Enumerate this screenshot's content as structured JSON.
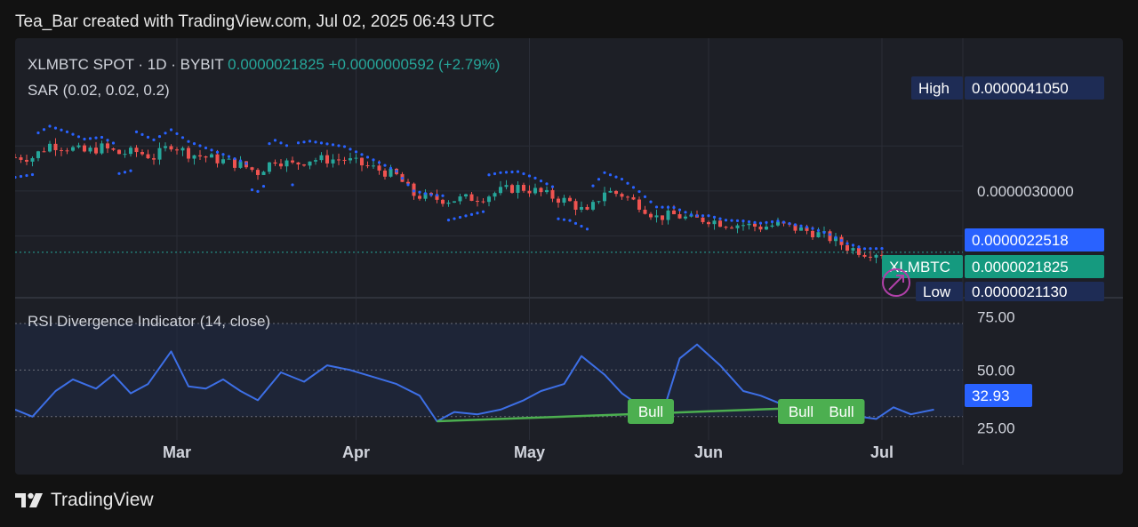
{
  "header": {
    "attribution": "Tea_Bar created with TradingView.com, Jul 02, 2025 06:43 UTC"
  },
  "legend": {
    "symbol": "XLMBTC SPOT · 1D · BYBIT",
    "price": "0.0000021825",
    "change": "+0.0000000592 (+2.79%)",
    "indicator": "SAR (0.02, 0.02, 0.2)",
    "rsi": "RSI Divergence Indicator (14, close)"
  },
  "footer": {
    "brand": "TradingView"
  },
  "colors": {
    "background": "#121212",
    "panel": "#1d1f26",
    "up": "#26a69a",
    "down": "#ef5350",
    "sar": "#2962ff",
    "rsi_line": "#3d6fe6",
    "bull": "#4caf50",
    "label_blue": "#2962ff",
    "label_navy": "#1e2c55",
    "label_green": "#159a7f"
  },
  "chart_data": [
    {
      "type": "candlestick",
      "title": "XLMBTC SPOT · 1D · BYBIT",
      "x_range": [
        "2025-02-01",
        "2025-07-15"
      ],
      "ylim": [
        1.6e-06,
        4.8e-06
      ],
      "price_scale": {
        "ticks": [
          "0.0000030000"
        ],
        "high": "0.0000041050",
        "low": "0.0000021130",
        "high_label": "High",
        "low_label": "Low",
        "marker": "0.0000022518",
        "last": "0.0000021825",
        "last_symbol": "XLMBTC"
      },
      "x_ticks": [
        {
          "label": "Mar",
          "date": "2025-03-01"
        },
        {
          "label": "Apr",
          "date": "2025-04-01"
        },
        {
          "label": "May",
          "date": "2025-05-01"
        },
        {
          "label": "Jun",
          "date": "2025-06-01"
        },
        {
          "label": "Jul",
          "date": "2025-07-01"
        }
      ],
      "candles_note": "close per session, mid-range estimate",
      "close": [
        [
          "2025-02-01",
          3.45e-06
        ],
        [
          "2025-02-04",
          3.45e-06
        ],
        [
          "2025-02-07",
          3.62e-06
        ],
        [
          "2025-02-10",
          3.58e-06
        ],
        [
          "2025-02-13",
          3.52e-06
        ],
        [
          "2025-02-16",
          3.58e-06
        ],
        [
          "2025-02-19",
          3.5e-06
        ],
        [
          "2025-02-22",
          3.52e-06
        ],
        [
          "2025-02-25",
          3.45e-06
        ],
        [
          "2025-02-28",
          3.62e-06
        ],
        [
          "2025-03-03",
          3.5e-06
        ],
        [
          "2025-03-06",
          3.45e-06
        ],
        [
          "2025-03-09",
          3.4e-06
        ],
        [
          "2025-03-12",
          3.35e-06
        ],
        [
          "2025-03-15",
          3.25e-06
        ],
        [
          "2025-03-18",
          3.42e-06
        ],
        [
          "2025-03-21",
          3.35e-06
        ],
        [
          "2025-03-24",
          3.42e-06
        ],
        [
          "2025-03-27",
          3.42e-06
        ],
        [
          "2025-03-30",
          3.42e-06
        ],
        [
          "2025-04-02",
          3.35e-06
        ],
        [
          "2025-04-05",
          3.28e-06
        ],
        [
          "2025-04-08",
          3.2e-06
        ],
        [
          "2025-04-11",
          2.95e-06
        ],
        [
          "2025-04-14",
          2.9e-06
        ],
        [
          "2025-04-17",
          2.88e-06
        ],
        [
          "2025-04-20",
          2.9e-06
        ],
        [
          "2025-04-23",
          2.92e-06
        ],
        [
          "2025-04-26",
          3e-06
        ],
        [
          "2025-04-29",
          3.05e-06
        ],
        [
          "2025-05-02",
          3e-06
        ],
        [
          "2025-05-05",
          2.92e-06
        ],
        [
          "2025-05-08",
          2.85e-06
        ],
        [
          "2025-05-11",
          2.7e-06
        ],
        [
          "2025-05-14",
          3e-06
        ],
        [
          "2025-05-17",
          2.95e-06
        ],
        [
          "2025-05-20",
          2.82e-06
        ],
        [
          "2025-05-23",
          2.65e-06
        ],
        [
          "2025-05-26",
          2.68e-06
        ],
        [
          "2025-05-29",
          2.62e-06
        ],
        [
          "2025-06-01",
          2.62e-06
        ],
        [
          "2025-06-04",
          2.56e-06
        ],
        [
          "2025-06-07",
          2.55e-06
        ],
        [
          "2025-06-10",
          2.52e-06
        ],
        [
          "2025-06-13",
          2.55e-06
        ],
        [
          "2025-06-16",
          2.5e-06
        ],
        [
          "2025-06-19",
          2.45e-06
        ],
        [
          "2025-06-22",
          2.37e-06
        ],
        [
          "2025-06-25",
          2.25e-06
        ],
        [
          "2025-06-28",
          2.18e-06
        ],
        [
          "2025-07-01",
          2.1825e-06
        ]
      ]
    },
    {
      "type": "line",
      "title": "RSI Divergence Indicator (14, close)",
      "ylim": [
        20,
        78
      ],
      "y_ticks": [
        "75.00",
        "50.00",
        "25.00"
      ],
      "current": "32.93",
      "rsi": [
        [
          "2025-02-01",
          33
        ],
        [
          "2025-02-04",
          30
        ],
        [
          "2025-02-08",
          41
        ],
        [
          "2025-02-11",
          46
        ],
        [
          "2025-02-15",
          42
        ],
        [
          "2025-02-18",
          48
        ],
        [
          "2025-02-21",
          40
        ],
        [
          "2025-02-24",
          44
        ],
        [
          "2025-02-28",
          58
        ],
        [
          "2025-03-03",
          43
        ],
        [
          "2025-03-06",
          42
        ],
        [
          "2025-03-09",
          46
        ],
        [
          "2025-03-12",
          41
        ],
        [
          "2025-03-15",
          37
        ],
        [
          "2025-03-19",
          49
        ],
        [
          "2025-03-23",
          45
        ],
        [
          "2025-03-27",
          52
        ],
        [
          "2025-03-31",
          50
        ],
        [
          "2025-04-04",
          47
        ],
        [
          "2025-04-08",
          44
        ],
        [
          "2025-04-12",
          39
        ],
        [
          "2025-04-15",
          28
        ],
        [
          "2025-04-18",
          32
        ],
        [
          "2025-04-22",
          31
        ],
        [
          "2025-04-26",
          33
        ],
        [
          "2025-04-30",
          37
        ],
        [
          "2025-05-03",
          41
        ],
        [
          "2025-05-07",
          44
        ],
        [
          "2025-05-10",
          56
        ],
        [
          "2025-05-14",
          48
        ],
        [
          "2025-05-17",
          40
        ],
        [
          "2025-05-21",
          33
        ],
        [
          "2025-05-24",
          31
        ],
        [
          "2025-05-27",
          55
        ],
        [
          "2025-05-30",
          61
        ],
        [
          "2025-06-03",
          52
        ],
        [
          "2025-06-07",
          41
        ],
        [
          "2025-06-10",
          39
        ],
        [
          "2025-06-14",
          35
        ],
        [
          "2025-06-17",
          36
        ],
        [
          "2025-06-20",
          34
        ],
        [
          "2025-06-24",
          36
        ],
        [
          "2025-06-27",
          30
        ],
        [
          "2025-06-30",
          29
        ],
        [
          "2025-07-03",
          34
        ],
        [
          "2025-07-06",
          31
        ],
        [
          "2025-07-10",
          33
        ]
      ],
      "divergence": {
        "from": [
          "2025-04-15",
          28
        ],
        "to": [
          "2025-06-20",
          34
        ]
      },
      "annotations": [
        {
          "label": "Bull",
          "date": "2025-05-22"
        },
        {
          "label": "Bull",
          "date": "2025-06-17"
        },
        {
          "label": "Bull",
          "date": "2025-06-24"
        }
      ]
    }
  ]
}
